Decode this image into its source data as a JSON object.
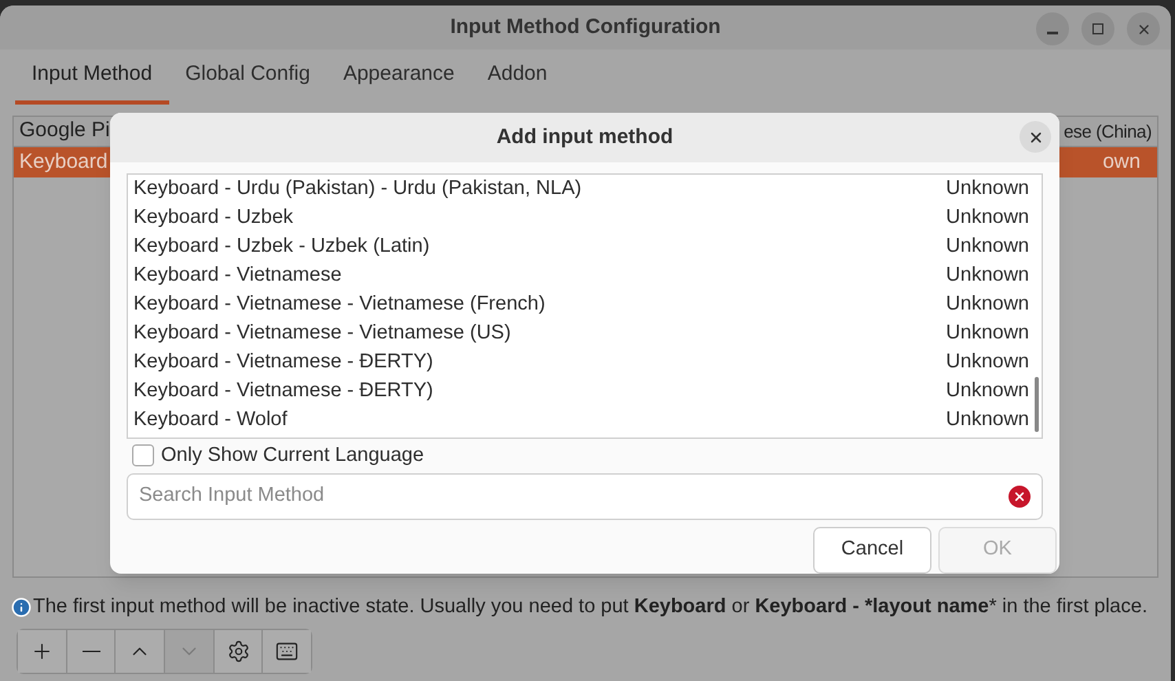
{
  "window": {
    "title": "Input Method Configuration"
  },
  "tabs": [
    {
      "label": "Input Method",
      "selected": true
    },
    {
      "label": "Global Config",
      "selected": false
    },
    {
      "label": "Appearance",
      "selected": false
    },
    {
      "label": "Addon",
      "selected": false
    }
  ],
  "table": {
    "header": [
      "Google Pi",
      "ese (China)"
    ],
    "rows": [
      {
        "cells": [
          "Keyboard",
          "own"
        ],
        "selected": true
      }
    ]
  },
  "dialog": {
    "title": "Add input method",
    "methods": [
      {
        "name": "Keyboard - Urdu (Pakistan) - Urdu (Pakistan, NLA)",
        "status": "Unknown"
      },
      {
        "name": "Keyboard - Uzbek",
        "status": "Unknown"
      },
      {
        "name": "Keyboard - Uzbek - Uzbek (Latin)",
        "status": "Unknown"
      },
      {
        "name": "Keyboard - Vietnamese",
        "status": "Unknown"
      },
      {
        "name": "Keyboard - Vietnamese - Vietnamese (French)",
        "status": "Unknown"
      },
      {
        "name": "Keyboard - Vietnamese - Vietnamese (US)",
        "status": "Unknown"
      },
      {
        "name": "Keyboard - Vietnamese - ĐERTY)",
        "status": "Unknown"
      },
      {
        "name": "Keyboard - Vietnamese - ĐERTY)",
        "status": "Unknown"
      },
      {
        "name": "Keyboard - Wolof",
        "status": "Unknown"
      }
    ],
    "only_current_language": {
      "label": "Only Show Current Language",
      "checked": false
    },
    "search": {
      "placeholder": "Search Input Method"
    },
    "buttons": [
      {
        "label": "Cancel",
        "disabled": false
      },
      {
        "label": "OK",
        "disabled": true
      }
    ]
  },
  "info": "The first input method will be inactive state. Usually you need to put **Keyboard** or **Keyboard -** ***layout name*** in the first place.",
  "toolbar": [
    {
      "kind": "add",
      "disabled": false
    },
    {
      "kind": "remove",
      "disabled": false
    },
    {
      "kind": "up",
      "disabled": false
    },
    {
      "kind": "down",
      "disabled": true
    },
    {
      "kind": "configure",
      "disabled": false
    },
    {
      "kind": "keyboard",
      "disabled": false
    }
  ]
}
